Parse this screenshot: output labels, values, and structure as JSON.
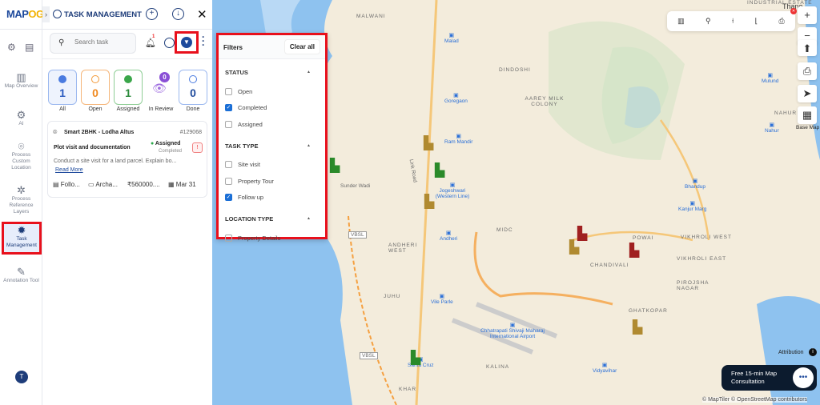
{
  "logo": {
    "text": "MAPOG"
  },
  "rail": {
    "items": [
      {
        "label": "Map Overview",
        "icon": "map-icon"
      },
      {
        "label": "AI",
        "icon": "gear-icon"
      },
      {
        "label": "Process Custom Location",
        "icon": "location-icon"
      },
      {
        "label": "Process Reference Layers",
        "icon": "layers-icon"
      },
      {
        "label": "Task Management",
        "icon": "task-icon",
        "active": true
      },
      {
        "label": "Annotation Tool",
        "icon": "pen-icon"
      }
    ],
    "avatar": "T"
  },
  "panel": {
    "title": "TASK MANAGEMENT",
    "search_placeholder": "Search task",
    "notif_count": "1",
    "tiles": [
      {
        "label": "All",
        "count": "1",
        "color": "#4a7be0"
      },
      {
        "label": "Open",
        "count": "0",
        "color": "#f39a3a"
      },
      {
        "label": "Assigned",
        "count": "1",
        "color": "#3aa64a"
      },
      {
        "label": "In Review",
        "count": "0",
        "color": "#8a4fd6"
      },
      {
        "label": "Done",
        "count": "0",
        "color": "#4a7be0"
      }
    ],
    "card": {
      "location": "Smart 2BHK - Lodha Altus",
      "id": "#129068",
      "title": "Plot visit and documentation",
      "status": "Assigned",
      "substatus": "Completed",
      "description": "Conduct a site visit for a land parcel. Explain bo...",
      "read_more": "Read More",
      "type": "Follo...",
      "assignee": "Archa...",
      "amount": "₹560000....",
      "date": "Mar 31"
    }
  },
  "filters": {
    "title": "Filters",
    "clear": "Clear all",
    "sections": [
      {
        "title": "STATUS",
        "options": [
          {
            "label": "Open",
            "checked": false
          },
          {
            "label": "Completed",
            "checked": true
          },
          {
            "label": "Assigned",
            "checked": false
          }
        ]
      },
      {
        "title": "TASK TYPE",
        "options": [
          {
            "label": "Site visit",
            "checked": false
          },
          {
            "label": "Property Tour",
            "checked": false
          },
          {
            "label": "Follow up",
            "checked": true
          }
        ]
      },
      {
        "title": "LOCATION TYPE",
        "options": [
          {
            "label": "Property Details",
            "checked": false
          }
        ]
      }
    ]
  },
  "map": {
    "areas": [
      "MALWANI",
      "DINDOSHI",
      "AAREY MILK COLONY",
      "ANDHERI WEST",
      "MIDC",
      "POWAI",
      "CHANDIVALI",
      "VIKHROLI WEST",
      "JUHU",
      "PIROJSHA NAGAR",
      "VIKHROLI EAST",
      "GHATKOPAR",
      "KALINA",
      "KHAR",
      "INDUSTRIAL ESTATE",
      "NAHUR",
      "Thane"
    ],
    "stations": [
      "Malad",
      "Goregaon",
      "Ram Mandir",
      "Jogeshwari (Western Line)",
      "Andheri",
      "Vile Parle",
      "Santa Cruz",
      "Kanjur Marg",
      "Bhandup",
      "Mulund",
      "Nahur",
      "Vidyavihar"
    ],
    "roads": [
      "Sunder Wadi",
      "Link Road",
      "VBSL",
      "VBSL"
    ],
    "airport": "Chhatrapati Shivaji Maharaj International Airport",
    "base_map": "Base Map",
    "attribution": "Attribution",
    "credits": "© MapTiler © OpenStreetMap contributors",
    "cta": "Free 15-min Map Consultation"
  }
}
